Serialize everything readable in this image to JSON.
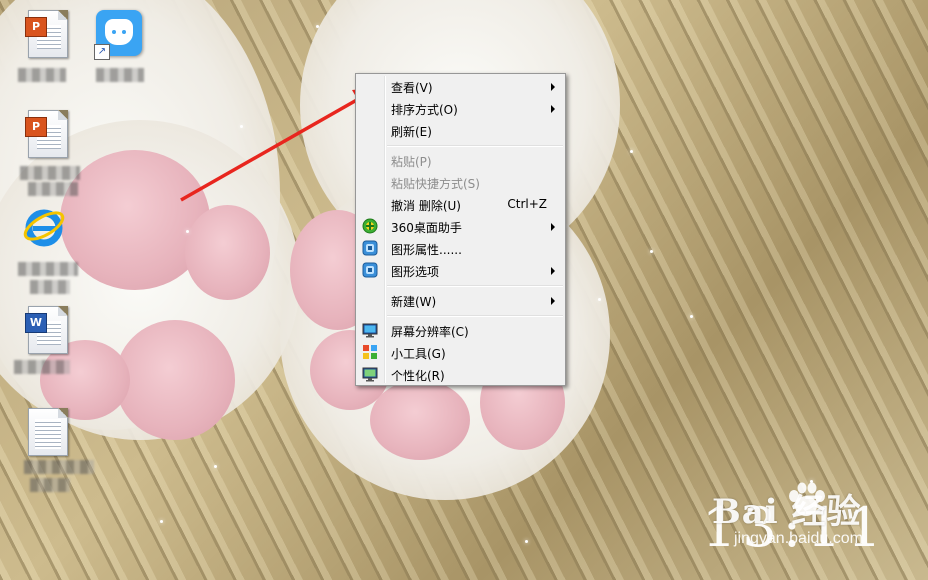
{
  "desktop": {
    "icons": [
      {
        "name": "powerpoint-document-1"
      },
      {
        "name": "app-shortcut"
      },
      {
        "name": "powerpoint-document-2"
      },
      {
        "name": "internet-explorer"
      },
      {
        "name": "word-document"
      },
      {
        "name": "text-document"
      }
    ]
  },
  "context_menu": {
    "items": [
      {
        "label": "查看(V)",
        "submenu": true
      },
      {
        "label": "排序方式(O)",
        "submenu": true
      },
      {
        "label": "刷新(E)"
      },
      {
        "label": "粘贴(P)",
        "disabled": true
      },
      {
        "label": "粘贴快捷方式(S)",
        "disabled": true
      },
      {
        "label": "撤消 删除(U)",
        "shortcut": "Ctrl+Z"
      },
      {
        "label": "360桌面助手",
        "icon": "360-assistant-icon",
        "submenu": true
      },
      {
        "label": "图形属性......",
        "icon": "graphics-properties-icon"
      },
      {
        "label": "图形选项",
        "icon": "graphics-options-icon",
        "submenu": true
      },
      {
        "label": "新建(W)",
        "submenu": true
      },
      {
        "label": "屏幕分辨率(C)",
        "icon": "screen-resolution-icon"
      },
      {
        "label": "小工具(G)",
        "icon": "gadgets-icon"
      },
      {
        "label": "个性化(R)",
        "icon": "personalize-icon"
      }
    ]
  },
  "watermark": {
    "brand": "Bai  经验",
    "url": "jingyan.baidu.com",
    "clock": "13:11"
  },
  "colors": {
    "annotation_arrow": "#e8261e",
    "menu_background": "#f0f0f0"
  }
}
